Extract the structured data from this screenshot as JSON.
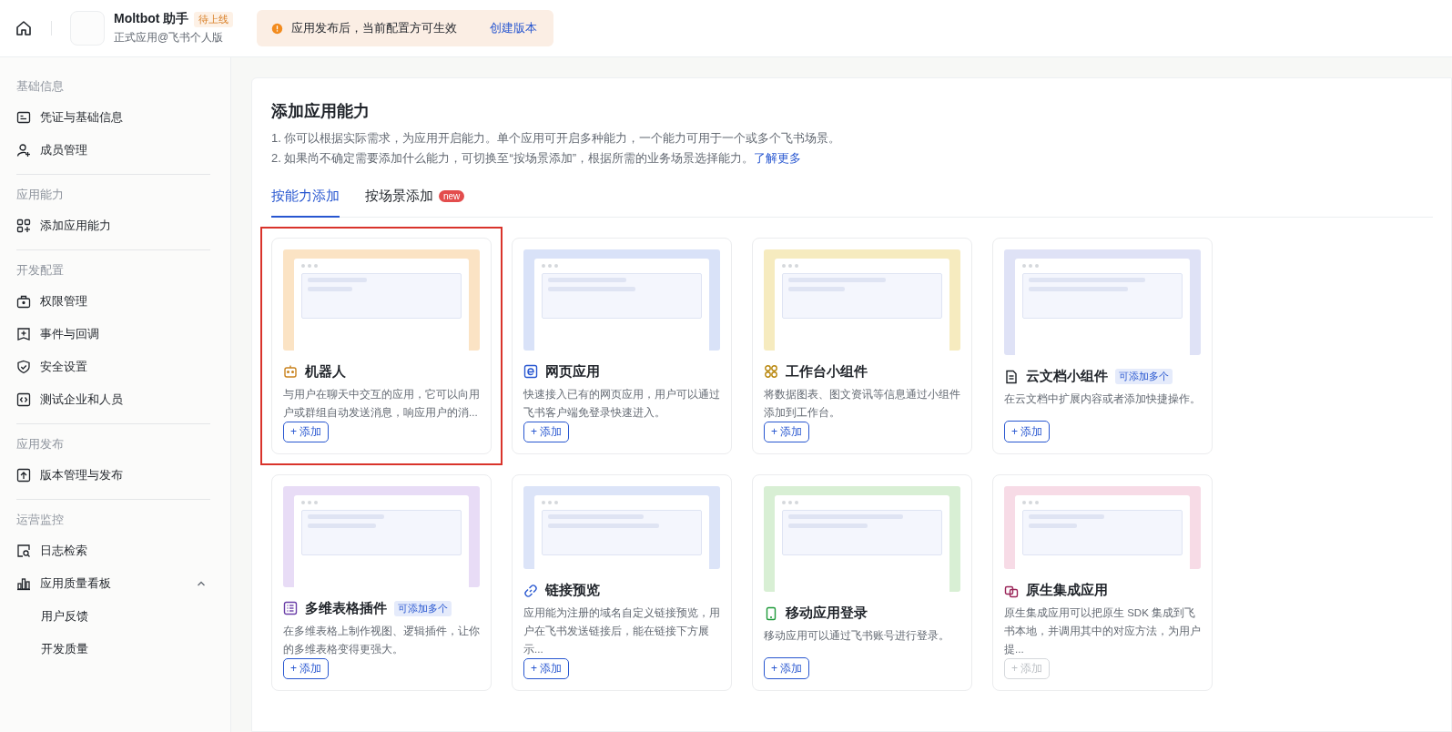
{
  "header": {
    "app_name": "Moltbot 助手",
    "status_badge": "待上线",
    "subtitle": "正式应用@飞书个人版",
    "notice": {
      "text": "应用发布后，当前配置方可生效",
      "link": "创建版本"
    }
  },
  "sidebar": {
    "sections": [
      {
        "title": "基础信息",
        "items": [
          {
            "label": "凭证与基础信息"
          },
          {
            "label": "成员管理"
          }
        ]
      },
      {
        "title": "应用能力",
        "items": [
          {
            "label": "添加应用能力"
          }
        ]
      },
      {
        "title": "开发配置",
        "items": [
          {
            "label": "权限管理"
          },
          {
            "label": "事件与回调"
          },
          {
            "label": "安全设置"
          },
          {
            "label": "测试企业和人员"
          }
        ]
      },
      {
        "title": "应用发布",
        "items": [
          {
            "label": "版本管理与发布"
          }
        ]
      },
      {
        "title": "运营监控",
        "items": [
          {
            "label": "日志检索"
          },
          {
            "label": "应用质量看板",
            "expanded": true,
            "children": [
              {
                "label": "用户反馈"
              },
              {
                "label": "开发质量"
              }
            ]
          }
        ]
      }
    ]
  },
  "main": {
    "title": "添加应用能力",
    "description": [
      "1. 你可以根据实际需求，为应用开启能力。单个应用可开启多种能力，一个能力可用于一个或多个飞书场景。",
      "2. 如果尚不确定需要添加什么能力，可切换至“按场景添加”，根据所需的业务场景选择能力。"
    ],
    "learn_more": "了解更多",
    "tabs": [
      {
        "label": "按能力添加",
        "selected": true
      },
      {
        "label": "按场景添加",
        "selected": false,
        "badge": "new"
      }
    ],
    "cards": [
      {
        "title": "机器人",
        "color": "#fbe3c4",
        "highlighted": true,
        "description": "与用户在聊天中交互的应用，它可以向用户或群组自动发送消息，响应用户的消...",
        "button": "+ 添加",
        "disabled": false
      },
      {
        "title": "网页应用",
        "color": "#d9e2f8",
        "highlighted": false,
        "description": "快速接入已有的网页应用，用户可以通过飞书客户端免登录快速进入。",
        "button": "+ 添加",
        "disabled": false
      },
      {
        "title": "工作台小组件",
        "color": "#f6ebbf",
        "highlighted": false,
        "description": "将数据图表、图文资讯等信息通过小组件添加到工作台。",
        "button": "+ 添加",
        "disabled": false
      },
      {
        "title": "云文档小组件",
        "color": "#dfe2f6",
        "highlighted": false,
        "tag": "可添加多个",
        "description": "在云文档中扩展内容或者添加快捷操作。",
        "button": "+ 添加",
        "disabled": false
      },
      {
        "title": "多维表格插件",
        "color": "#e8dcf6",
        "highlighted": false,
        "tag": "可添加多个",
        "description": "在多维表格上制作视图、逻辑插件，让你的多维表格变得更强大。",
        "button": "+ 添加",
        "disabled": false
      },
      {
        "title": "链接预览",
        "color": "#dce4f8",
        "highlighted": false,
        "description": "应用能为注册的域名自定义链接预览，用户在飞书发送链接后，能在链接下方展示...",
        "button": "+ 添加",
        "disabled": false
      },
      {
        "title": "移动应用登录",
        "color": "#d8efd4",
        "highlighted": false,
        "description": "移动应用可以通过飞书账号进行登录。",
        "button": "+ 添加",
        "disabled": false
      },
      {
        "title": "原生集成应用",
        "color": "#f7dbe6",
        "highlighted": false,
        "description": "原生集成应用可以把原生 SDK 集成到飞书本地，并调用其中的对应方法，为用户提...",
        "button": "+ 添加",
        "disabled": true
      }
    ]
  }
}
